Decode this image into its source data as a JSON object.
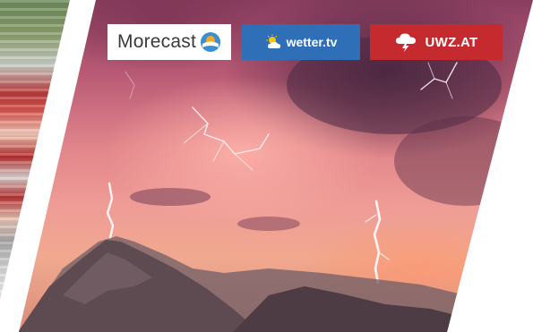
{
  "logos": {
    "morecast": {
      "text": "Morecast",
      "icon": "morecast-sun-icon"
    },
    "wetter": {
      "text": "wetter.tv",
      "icon": "weather-sun-cloud-icon"
    },
    "uwz": {
      "text": "UWZ.AT",
      "icon": "storm-cloud-lightning-icon"
    }
  },
  "photo": {
    "subject": "thunderstorm-lightning-mountain"
  },
  "colors": {
    "wetter_blue": "#2f6fb8",
    "uwz_red": "#c42a2e",
    "morecast_orange": "#f5a623",
    "morecast_blue": "#3a8fd0"
  }
}
